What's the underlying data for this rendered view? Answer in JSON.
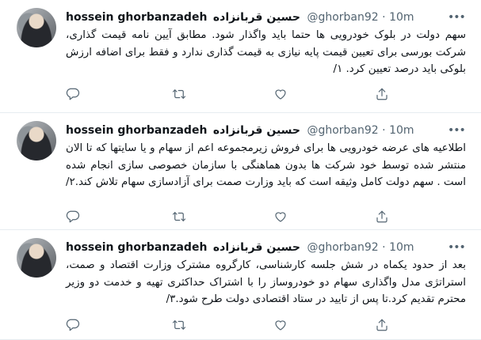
{
  "tweets": [
    {
      "author_name": "hossein ghorbanzadeh",
      "author_name_fa": "حسین قربانزاده",
      "handle": "@ghorban92",
      "separator": "·",
      "time": "10m",
      "text": "سهم دولت در بلوک خودرویی ها حتما باید واگذار شود. مطابق آیین نامه قیمت گذاری، شرکت بورسی برای تعیین قیمت پایه نیازی به قیمت گذاری ندارد و فقط برای اضافه ارزش بلوکی باید درصد تعیین کرد. ۱/"
    },
    {
      "author_name": "hossein ghorbanzadeh",
      "author_name_fa": "حسین قربانزاده",
      "handle": "@ghorban92",
      "separator": "·",
      "time": "10m",
      "text": "اطلاعیه های عرضه خودرویی ها برای فروش زیرمجموعه اعم از سهام و یا سایتها که تا الان منتشر شده توسط خود شرکت ها بدون هماهنگی با سازمان خصوصی سازی انجام شده است . سهم دولت کامل وثیقه است که باید وزارت صمت برای آزادسازی سهام تلاش کند.۲/"
    },
    {
      "author_name": "hossein ghorbanzadeh",
      "author_name_fa": "حسین قربانزاده",
      "handle": "@ghorban92",
      "separator": "·",
      "time": "10m",
      "text": "بعد از حدود یکماه در شش جلسه کارشناسی، کارگروه مشترک وزارت اقتصاد و صمت، استراتژی مدل واگذاری سهام دو خودروساز را با اشتراک حداکثری تهیه و خدمت دو وزیر محترم تقدیم کرد.تا پس از تایید در ستاد اقتصادی دولت طرح شود.۳/"
    }
  ],
  "icons": {
    "more": "more-horizontal-icon",
    "reply": "reply-icon",
    "retweet": "retweet-icon",
    "like": "heart-icon",
    "share": "share-icon"
  },
  "colors": {
    "text": "#0f1419",
    "secondary": "#536471",
    "divider": "#e6ecf0"
  }
}
